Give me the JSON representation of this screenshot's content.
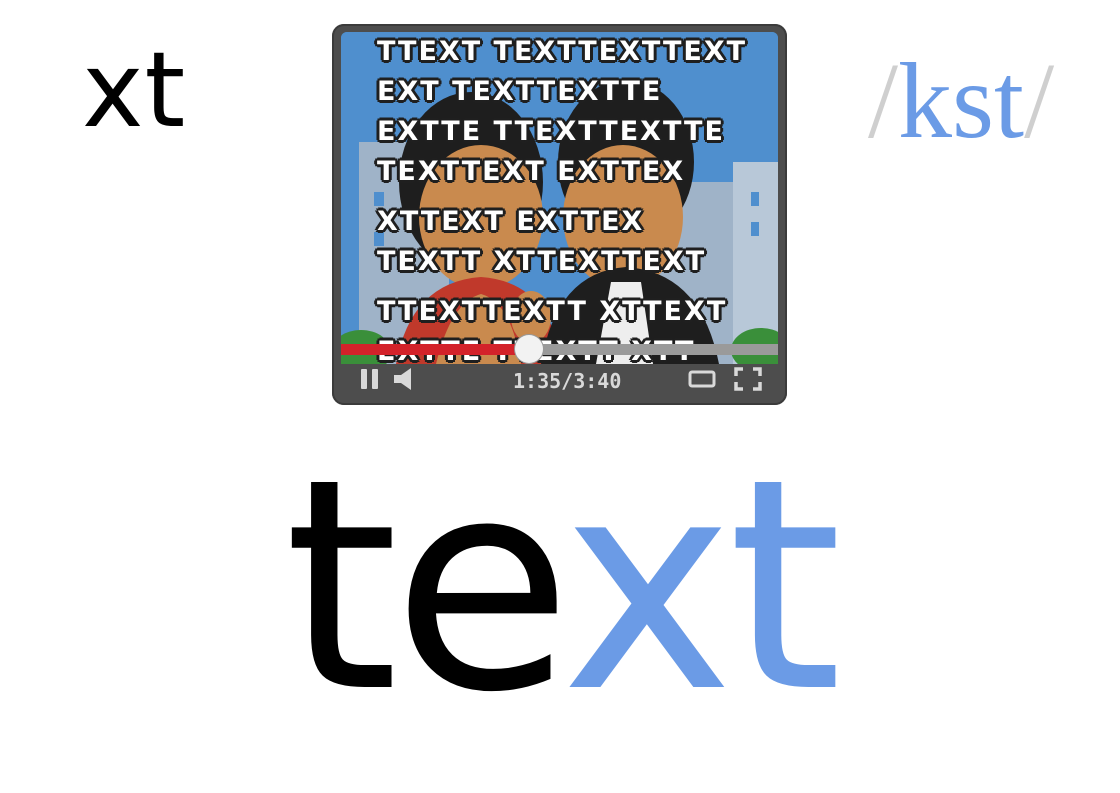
{
  "corner_word": "xt",
  "phonetic": {
    "open_slash": "/",
    "sounds": "kst",
    "close_slash": "/"
  },
  "player": {
    "subtitle_lines": [
      "TTEXT TEXTTEXTTEXT",
      "EXT TEXTTEXTTE",
      "EXTTE TTEXTTEXTTE",
      "TEXTTEXT EXTTEX",
      "XTTEXT EXTTEX",
      "TEXTT XTTEXTTEXT",
      "TTEXTTEXTT XTTEXT",
      "EXTTE TTEXTT XTT"
    ],
    "time": "1:35/3:40",
    "progress": 0.43,
    "buttons": [
      "pause-icon",
      "volume-icon",
      "theater-mode-icon",
      "fullscreen-icon"
    ]
  },
  "word": {
    "plain": "te",
    "highlight": "xt"
  },
  "colors": {
    "highlight": "#6b9be6",
    "slash": "#cfcfcf",
    "progress": "#d3222a",
    "player_body": "#4d4d4d"
  }
}
